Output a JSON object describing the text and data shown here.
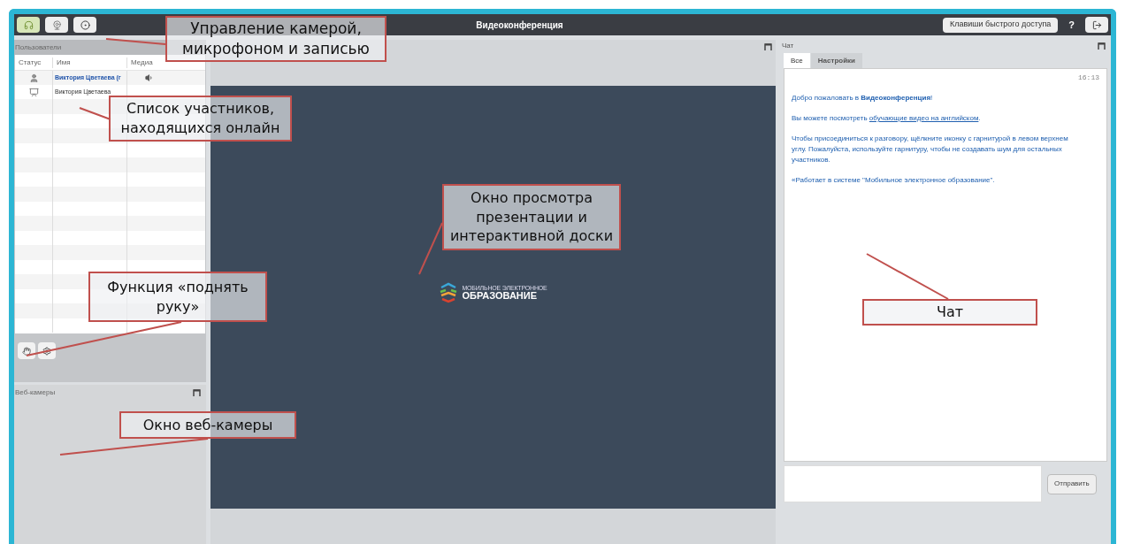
{
  "toolbar": {
    "title": "Видеоконференция",
    "shortcuts_button": "Клавиши быстрого доступа",
    "help_button": "?"
  },
  "users_panel": {
    "title": "Пользователи",
    "columns": [
      "Статус",
      "Имя",
      "Медиа"
    ],
    "rows": [
      {
        "kind": "self",
        "name": "Виктория Цветаева (г"
      },
      {
        "kind": "presenter",
        "name": "Виктория Цветаева"
      }
    ]
  },
  "webcams_panel": {
    "title": "Веб-камеры"
  },
  "logo": {
    "top": "МОБИЛЬНОЕ ЭЛЕКТРОННОЕ",
    "bottom": "ОБРАЗОВАНИЕ"
  },
  "chat": {
    "title": "Чат",
    "tabs": [
      {
        "label": "Все",
        "selected": true
      },
      {
        "label": "Настройки",
        "selected": false
      }
    ],
    "time": "16:13",
    "messages": [
      {
        "kind": "text",
        "text": "Добро пожаловать в **Видеоконференция**!"
      },
      {
        "kind": "link",
        "before": "Вы можете посмотреть",
        "link": "обучающие видео на английском",
        "after": "."
      },
      {
        "kind": "text",
        "text": "Чтобы присоединиться к разговору, щёлкните иконку с гарнитурой в левом верхнем углу. Пожалуйста, используйте гарнитуру, чтобы не создавать шум для остальных участников."
      },
      {
        "kind": "text",
        "text": "«Работает в системе \"Мобильное электронное образование\"."
      }
    ],
    "send_button": "Отправить"
  },
  "callouts": [
    {
      "text": "Управление камерой, микрофоном и записью"
    },
    {
      "text": "Список участников, находящихся онлайн"
    },
    {
      "text": "Окно просмотра презентации и интерактивной доски"
    },
    {
      "text": "Функция «поднять руку»"
    },
    {
      "text": "Окно веб-камеры"
    },
    {
      "text": "Чат"
    }
  ]
}
